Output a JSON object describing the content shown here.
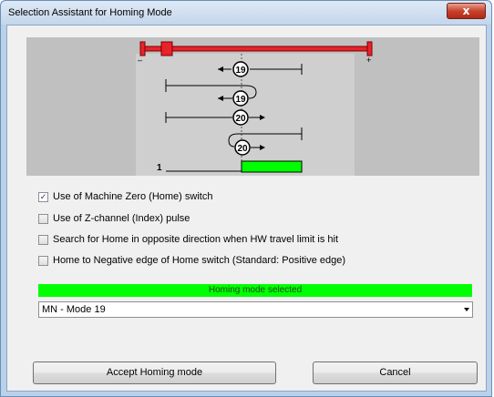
{
  "window": {
    "title": "Selection Assistant for Homing Mode",
    "close_glyph": "x"
  },
  "diagram": {
    "minus_label": "–",
    "plus_label": "+",
    "labels": [
      "19",
      "19",
      "20",
      "20"
    ],
    "index_label": "1",
    "colors": {
      "travel_bar": "#e8232a",
      "index_signal": "#00ff00",
      "background": "#c0c0c0"
    }
  },
  "options": [
    {
      "label": "Use of Machine Zero (Home) switch",
      "checked": true
    },
    {
      "label": "Use of Z-channel (Index) pulse",
      "checked": false
    },
    {
      "label": "Search for Home in opposite direction when HW travel limit is hit",
      "checked": false
    },
    {
      "label": "Home to Negative edge of Home switch (Standard: Positive edge)",
      "checked": false
    }
  ],
  "status": {
    "text": "Homing mode selected",
    "color": "#00ff00"
  },
  "mode_select": {
    "value": "MN - Mode 19"
  },
  "buttons": {
    "accept": "Accept Homing mode",
    "cancel": "Cancel"
  }
}
